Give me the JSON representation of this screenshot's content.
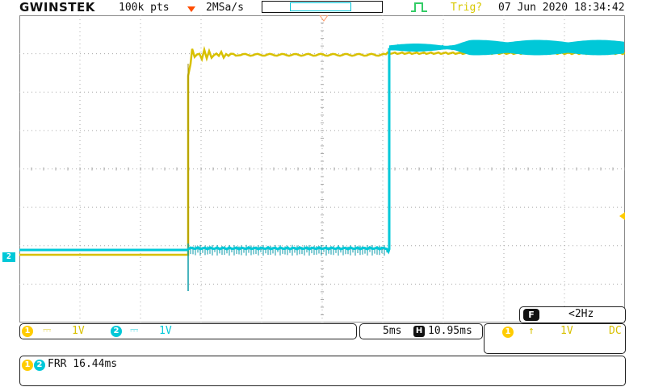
{
  "brand": "GWINSTEK",
  "status": {
    "points": "100k pts",
    "sample_rate": "2MSa/s",
    "trigger_status": "Trig?",
    "datetime": "07 Jun 2020 18:34:42"
  },
  "colors": {
    "ch1": "#ffcc00",
    "ch2": "#00c8d8",
    "grid": "#a8a8a8",
    "trigger_marker": "#ff4d00"
  },
  "channels": {
    "ch1": {
      "number": "1",
      "coupling_symbol": "⎓",
      "scale": "1V"
    },
    "ch2": {
      "number": "2",
      "coupling_symbol": "⎓",
      "scale": "1V"
    }
  },
  "ch2_marker_label": "2",
  "timebase": {
    "scale": "5ms",
    "position_label": "H",
    "position": "10.95ms"
  },
  "trigger": {
    "source": "1",
    "edge_symbol": "↑",
    "level": "1V",
    "coupling": "DC"
  },
  "frequency": {
    "label": "F",
    "value": "<2Hz"
  },
  "measurement": {
    "channels": [
      "1",
      "2"
    ],
    "text": "FRR 16.44ms"
  }
}
